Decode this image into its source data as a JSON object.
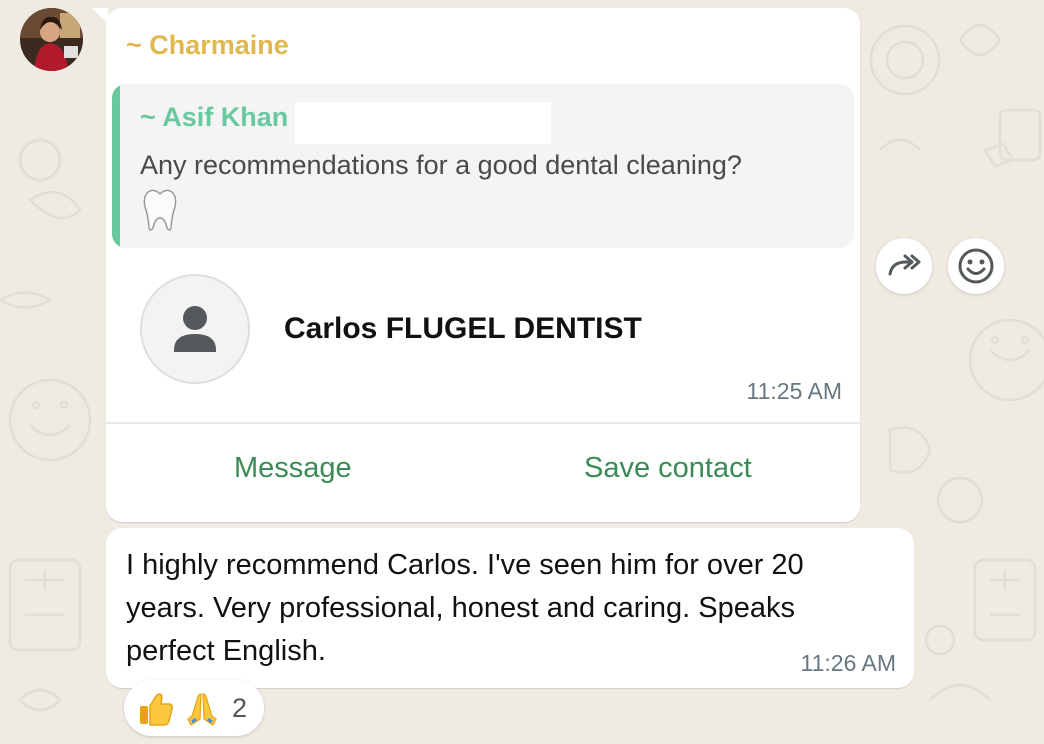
{
  "colors": {
    "chat_background": "#efeae2",
    "bubble": "#ffffff",
    "sender_name": "#e0b84f",
    "quote_author": "#68c99e",
    "action_link": "#3a8b56",
    "timestamp": "#667781"
  },
  "message_1": {
    "sender": "~ Charmaine",
    "quoted": {
      "author": "~ Asif Khan",
      "text": "Any recommendations for a good dental cleaning?",
      "emoji": "tooth-icon"
    },
    "contact_card": {
      "name": "Carlos FLUGEL DENTIST",
      "avatar": "person-icon",
      "time": "11:25 AM",
      "actions": {
        "message_label": "Message",
        "save_label": "Save contact"
      }
    }
  },
  "message_2": {
    "text": "I highly recommend Carlos. I've seen him for over 20 years. Very professional, honest and caring. Speaks perfect English.",
    "time": "11:26 AM",
    "reactions": {
      "emojis": [
        "thumbs-up-icon",
        "folded-hands-icon"
      ],
      "count": "2"
    }
  },
  "hover_actions": [
    "forward-icon",
    "emoji-icon"
  ]
}
